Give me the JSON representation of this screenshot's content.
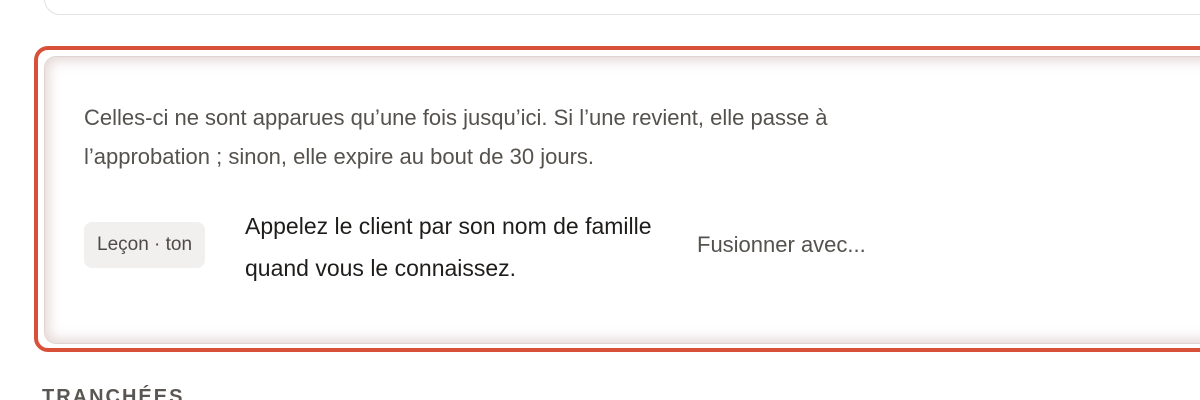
{
  "card": {
    "description": "Celles-ci ne sont apparues qu’une fois jusqu’ici. Si l’une revient, elle passe à l’approbation ; sinon, elle expire au bout de 30 jours.",
    "highlight_color": "#d9503a",
    "item": {
      "tag": "Leçon · ton",
      "text": "Appelez le client par son nom de famille quand vous le connaissez.",
      "merge_label": "Fusionner avec..."
    }
  },
  "next_section": {
    "heading": "TRANCHÉES"
  }
}
